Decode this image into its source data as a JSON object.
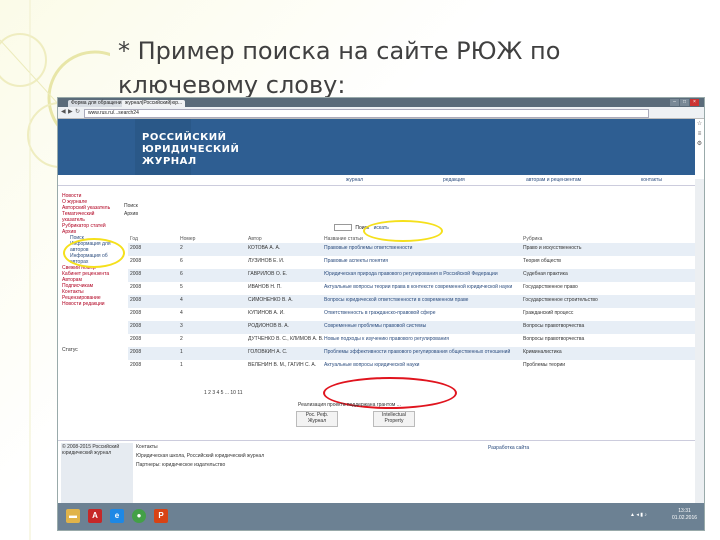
{
  "slide": {
    "title": "* Пример поиска на сайте РЮЖ по ключевому слову:"
  },
  "browser": {
    "tabs": [
      "Форма для обращени...",
      "журнал|Российский|юр..."
    ],
    "url": "www.rus.ru/...search24",
    "window_buttons": [
      "–",
      "□",
      "×"
    ]
  },
  "site": {
    "logo_lines": [
      "РОССИЙСКИЙ",
      "ЮРИДИЧЕСКИЙ",
      "ЖУРНАЛ"
    ],
    "menu": [
      "журнал",
      "редакция",
      "авторам и рецензентам",
      "контакты"
    ],
    "sidebar": [
      "Новости",
      "О журнале",
      "Авторский указатель",
      "Тематический указатель",
      "Рубрикатор статей",
      "Архив",
      "Поиск",
      "Информация для авторов",
      "Информация об авторах",
      "Свежий номер",
      "Кабинет рецензента",
      "Авторам",
      "Подписчикам",
      "Контакты",
      "Рецензирование",
      "Новости редакции"
    ],
    "sidebar_status": "Статус",
    "main_header": [
      "Поиск",
      "Архив"
    ],
    "search_label": "Поиск",
    "search_button": "искать",
    "columns": [
      "Год",
      "Номер",
      "Автор",
      "Название статьи",
      "Рубрика"
    ],
    "rows": [
      {
        "year": "2008",
        "num": "2",
        "author": "КОТОВА А. А.",
        "title": "Правовые проблемы ответственности",
        "rubric": "Право и искусственность"
      },
      {
        "year": "2008",
        "num": "6",
        "author": "ЛУЗИНОВ Е. И.",
        "title": "Правовые аспекты понятия",
        "rubric": "Теория обществ"
      },
      {
        "year": "2008",
        "num": "6",
        "author": "ГАВРИЛОВ О. Е.",
        "title": "Юридическая природа правового регулирования в Российской Федерации",
        "rubric": "Судебная практика"
      },
      {
        "year": "2008",
        "num": "5",
        "author": "ИВАНОВ Н. П.",
        "title": "Актуальные вопросы теории права в контексте современной юридической науки",
        "rubric": "Государственное право"
      },
      {
        "year": "2008",
        "num": "4",
        "author": "СИМОНЕНКО В. А.",
        "title": "Вопросы юридической ответственности в современном праве",
        "rubric": "Государственное строительство"
      },
      {
        "year": "2008",
        "num": "4",
        "author": "КУПИНОВ А. И.",
        "title": "Ответственность в гражданско-правовой сфере",
        "rubric": "Гражданский процесс"
      },
      {
        "year": "2008",
        "num": "3",
        "author": "РОДИОНОВ В. А.",
        "title": "Современные проблемы правовой системы",
        "rubric": "Вопросы правотворчества"
      },
      {
        "year": "2008",
        "num": "2",
        "author": "ДУТЧЕНКО В. С., КЛИМОВ А. В.",
        "title": "Новые подходы к изучению правового регулирования",
        "rubric": "Вопросы правотворчества"
      },
      {
        "year": "2008",
        "num": "1",
        "author": "ГОЛОВКИН А. С.",
        "title": "Проблемы эффективности правового регулирования общественных отношений",
        "rubric": "Криминалистика"
      },
      {
        "year": "2008",
        "num": "1",
        "author": "ВЕЛЕНИН В. М., ГАГИН С. А.",
        "title": "Актуальные вопросы юридической науки",
        "rubric": "Проблемы теории"
      }
    ],
    "pager": "1  2  3  4  5  ...  10  11",
    "footnote": "Реализация проекта поддержана грантом ...",
    "badges": [
      "Рос. Реф. Журнал",
      "Intellectual Property"
    ],
    "footer_left": "© 2008-2015 Российский юридический журнал",
    "footer_mid": [
      "Контакты",
      "Юридическая школа, Российский юридический журнал",
      "Партнеры: юридическое издательство"
    ],
    "footer_right": "Разработка сайта"
  },
  "taskbar": {
    "icons": [
      "folder-icon",
      "pdf-icon",
      "ie-icon",
      "chrome-icon",
      "ppt-icon"
    ],
    "clock_time": "13:31",
    "clock_date": "01.02.2016"
  },
  "colors": {
    "banner": "#2e5e92",
    "highlight_yellow": "#f5e01b",
    "highlight_red": "#e0141e",
    "taskbar": "#6c8193"
  }
}
